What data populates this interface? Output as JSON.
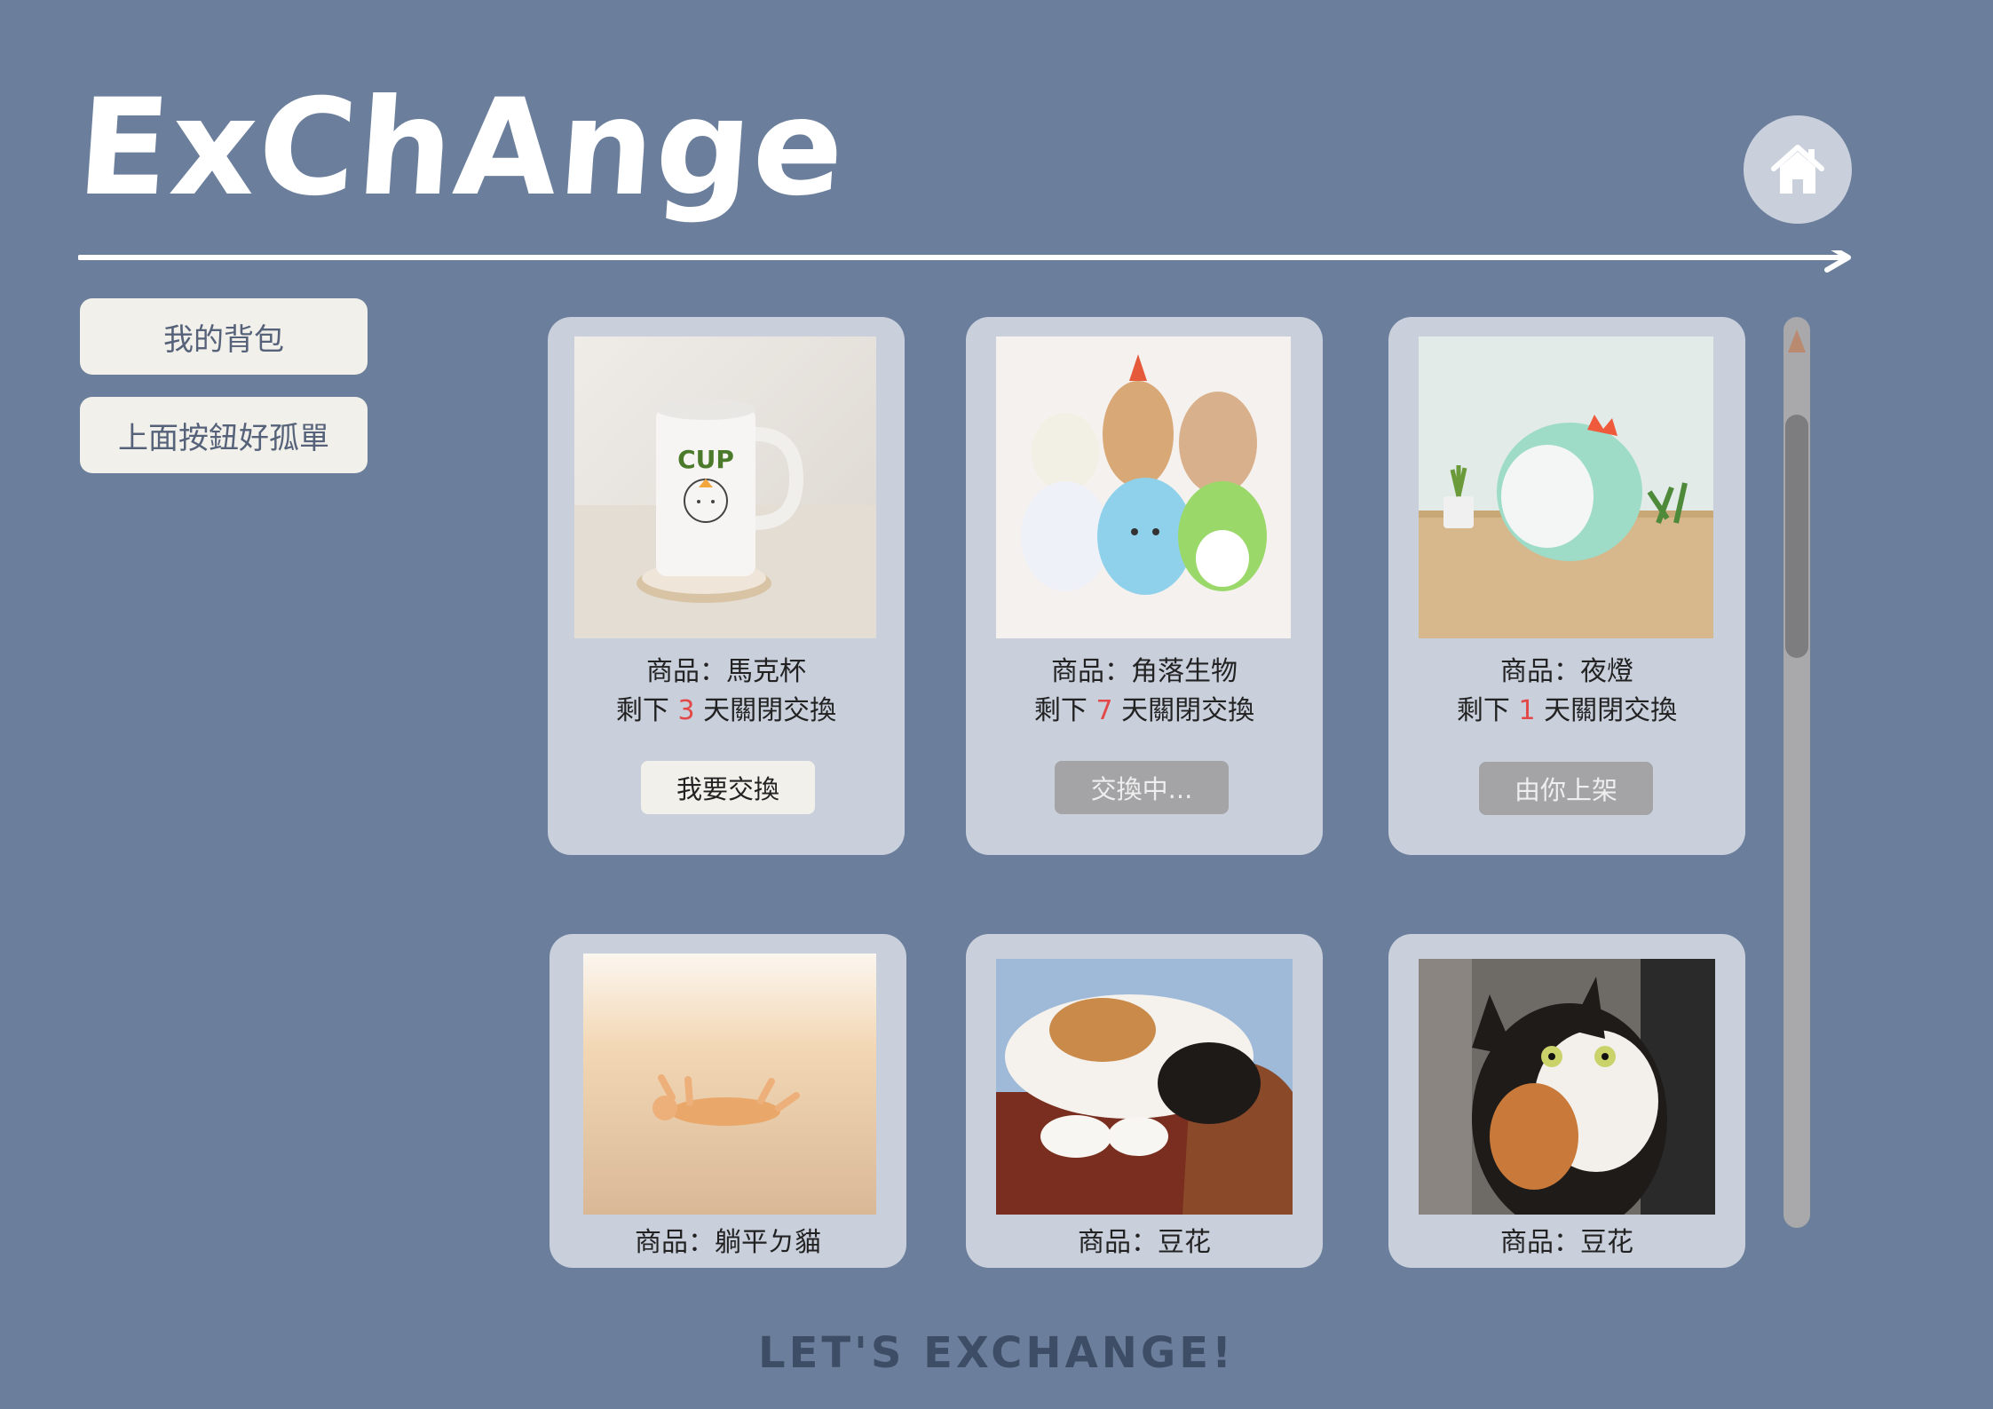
{
  "header": {
    "title": "ExChAnge"
  },
  "sidebar": {
    "buttons": [
      {
        "label": "我的背包"
      },
      {
        "label": "上面按鈕好孤單"
      }
    ]
  },
  "cards": [
    {
      "product": "商品：馬克杯",
      "remain_prefix": "剩下 ",
      "days": "3",
      "remain_suffix": " 天關閉交換",
      "action": "我要交換",
      "action_state": "enabled",
      "image": "mug-photo"
    },
    {
      "product": "商品：角落生物",
      "remain_prefix": "剩下 ",
      "days": "7",
      "remain_suffix": " 天關閉交換",
      "action": "交換中...",
      "action_state": "disabled",
      "image": "plush-toys-photo"
    },
    {
      "product": "商品：夜燈",
      "remain_prefix": "剩下 ",
      "days": "1",
      "remain_suffix": " 天關閉交換",
      "action": "由你上架",
      "action_state": "disabled",
      "image": "dino-lamp-photo"
    },
    {
      "product": "商品：躺平ㄉ貓",
      "image": "lying-cat-photo"
    },
    {
      "product": "商品：豆花",
      "image": "sleeping-cat-photo"
    },
    {
      "product": "商品：豆花",
      "image": "calico-cat-photo"
    }
  ],
  "footer": {
    "text": "LET'S EXCHANGE!"
  },
  "colors": {
    "background": "#6b7f9c",
    "card": "#c9d0dc",
    "button": "#f2f0ea",
    "disabled_button": "#a4a4a6",
    "countdown": "#e34848"
  }
}
